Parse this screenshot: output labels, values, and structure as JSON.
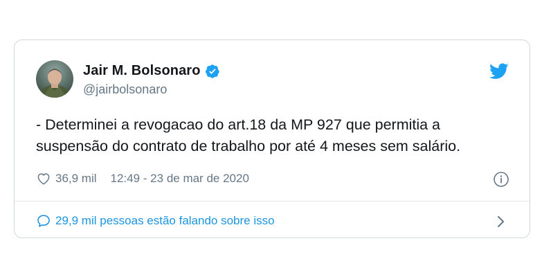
{
  "author": {
    "name": "Jair M. Bolsonaro",
    "handle": "@jairbolsonaro",
    "verified": true
  },
  "tweet": {
    "text_line1": "- Determinei a revogacao do art.18 da MP 927 que permitia a",
    "text_line2": "suspensão do contrato de trabalho por até 4 meses sem salário."
  },
  "meta": {
    "likes": "36,9 mil",
    "timestamp": "12:49 - 23 de mar de 2020"
  },
  "conversation": {
    "label": "29,9 mil pessoas estão falando sobre isso"
  },
  "colors": {
    "twitter_blue": "#1da1f2",
    "link_blue": "#1b95e0",
    "text": "#14171a",
    "muted": "#657786"
  },
  "icons": [
    "avatar",
    "verified-badge-icon",
    "twitter-bird-icon",
    "heart-icon",
    "info-icon",
    "speech-bubble-icon",
    "chevron-right-icon"
  ]
}
